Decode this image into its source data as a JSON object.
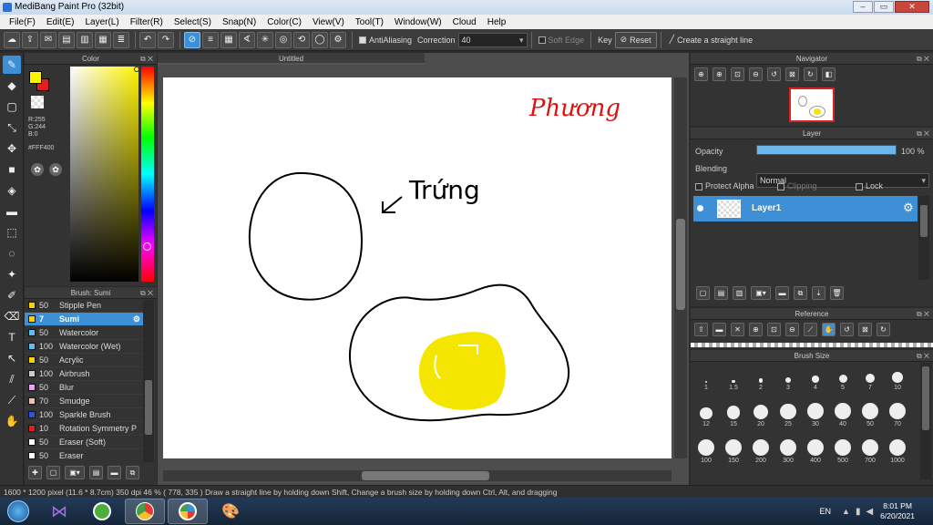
{
  "window": {
    "title": "MediBang Paint Pro (32bit)",
    "min": "–",
    "max": "▭",
    "close": "✕"
  },
  "menu": [
    "File(F)",
    "Edit(E)",
    "Layer(L)",
    "Filter(R)",
    "Select(S)",
    "Snap(N)",
    "Color(C)",
    "View(V)",
    "Tool(T)",
    "Window(W)",
    "Cloud",
    "Help"
  ],
  "toolbar": {
    "antialiasing": "AntiAliasing",
    "correction_label": "Correction",
    "correction_value": "40",
    "soft_edge": "Soft Edge",
    "key": "Key",
    "reset": "Reset",
    "straight_line": "Create a straight line"
  },
  "color_panel": {
    "title": "Color",
    "r": "R:255",
    "g": "G:244",
    "b": "B:0",
    "hex": "#FFF400",
    "fg": "#FFF400",
    "bg": "#e02020"
  },
  "canvas": {
    "tab": "Untitled",
    "label_truong": "Trứng",
    "label_phuong": "Phương"
  },
  "brush_panel": {
    "title": "Brush: Sumi",
    "items": [
      {
        "size": "50",
        "name": "Stipple Pen",
        "color": "#f5d20a"
      },
      {
        "size": "7",
        "name": "Sumi",
        "color": "#f5d20a"
      },
      {
        "size": "50",
        "name": "Watercolor",
        "color": "#5bc0f0"
      },
      {
        "size": "100",
        "name": "Watercolor (Wet)",
        "color": "#5bc0f0"
      },
      {
        "size": "50",
        "name": "Acrylic",
        "color": "#f5d20a"
      },
      {
        "size": "100",
        "name": "Airbrush",
        "color": "#cccccc"
      },
      {
        "size": "50",
        "name": "Blur",
        "color": "#f0a0f0"
      },
      {
        "size": "70",
        "name": "Smudge",
        "color": "#f0c0c0"
      },
      {
        "size": "100",
        "name": "Sparkle Brush",
        "color": "#3050e0"
      },
      {
        "size": "10",
        "name": "Rotation Symmetry P",
        "color": "#e02020"
      },
      {
        "size": "50",
        "name": "Eraser (Soft)",
        "color": "#ffffff"
      },
      {
        "size": "50",
        "name": "Eraser",
        "color": "#ffffff"
      }
    ]
  },
  "navigator": {
    "title": "Navigator"
  },
  "layer_panel": {
    "title": "Layer",
    "opacity_label": "Opacity",
    "opacity_value": "100 %",
    "blending_label": "Blending",
    "blending_value": "Normal",
    "protect_alpha": "Protect Alpha",
    "clipping": "Clipping",
    "lock": "Lock",
    "layer_name": "Layer1",
    "opacity_fraction": 1.0
  },
  "reference": {
    "title": "Reference"
  },
  "brush_size": {
    "title": "Brush Size",
    "sizes": [
      "1",
      "1.5",
      "2",
      "3",
      "4",
      "5",
      "7",
      "10",
      "12",
      "15",
      "20",
      "25",
      "30",
      "40",
      "50",
      "70",
      "100",
      "150",
      "200",
      "300",
      "400",
      "500",
      "700",
      "1000"
    ]
  },
  "status": "1600 * 1200 pixel  (11.6 * 8.7cm)  350 dpi  46 %  ( 778, 335 )  Draw a straight line by holding down Shift, Change a brush size by holding down Ctrl, Alt, and dragging",
  "taskbar": {
    "lang": "EN",
    "time": "8:01 PM",
    "date": "6/20/2021"
  }
}
